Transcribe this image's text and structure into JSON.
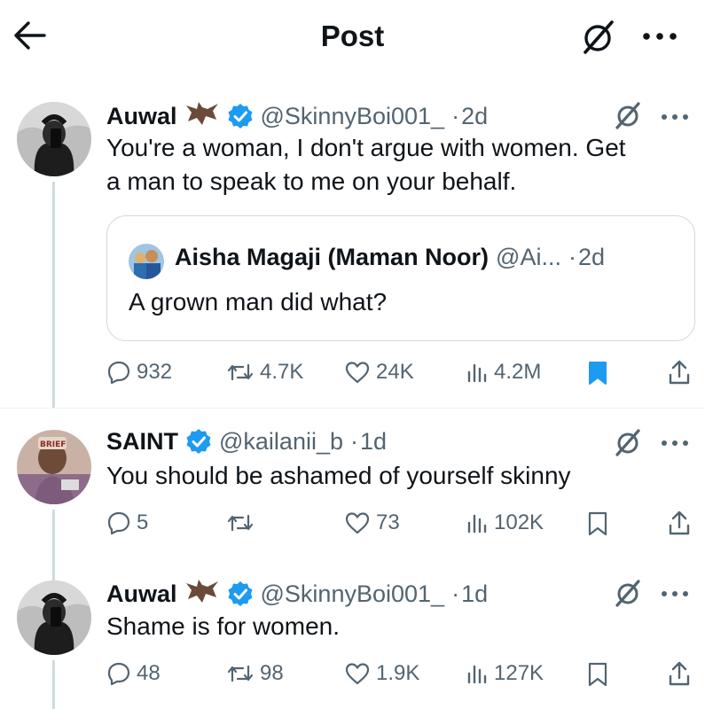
{
  "header": {
    "title": "Post",
    "back_icon": "arrow-left-icon",
    "grok_icon": "grok-icon",
    "more_icon": "more-horizontal-icon"
  },
  "posts": [
    {
      "name": "Auwal",
      "emoji": "bat",
      "handle": "@SkinnyBoi001_",
      "sep": "·",
      "time": "2d",
      "text_line1": "You're a woman, I don't argue with women. Get",
      "text_line2": "a man to speak to me on your behalf.",
      "quote": {
        "name": "Aisha Magaji (Maman Noor)",
        "handle": "@Ai...",
        "sep": "·",
        "time": "2d",
        "text": "A grown man did what?"
      },
      "stats": {
        "replies": "932",
        "reposts": "4.7K",
        "likes": "24K",
        "views": "4.2M"
      },
      "bookmarked": true
    },
    {
      "name": "SAINT",
      "handle": "@kailanii_b",
      "sep": "·",
      "time": "1d",
      "text": "You should be ashamed of yourself skinny",
      "stats": {
        "replies": "5",
        "reposts": "",
        "likes": "73",
        "views": "102K"
      },
      "bookmarked": false
    },
    {
      "name": "Auwal",
      "emoji": "bat",
      "handle": "@SkinnyBoi001_",
      "sep": "·",
      "time": "1d",
      "text": "Shame is for women.",
      "stats": {
        "replies": "48",
        "reposts": "98",
        "likes": "1.9K",
        "views": "127K"
      },
      "bookmarked": false
    }
  ],
  "colors": {
    "accent": "#1d9bf0",
    "muted": "#536471",
    "border": "#cfd9de"
  }
}
